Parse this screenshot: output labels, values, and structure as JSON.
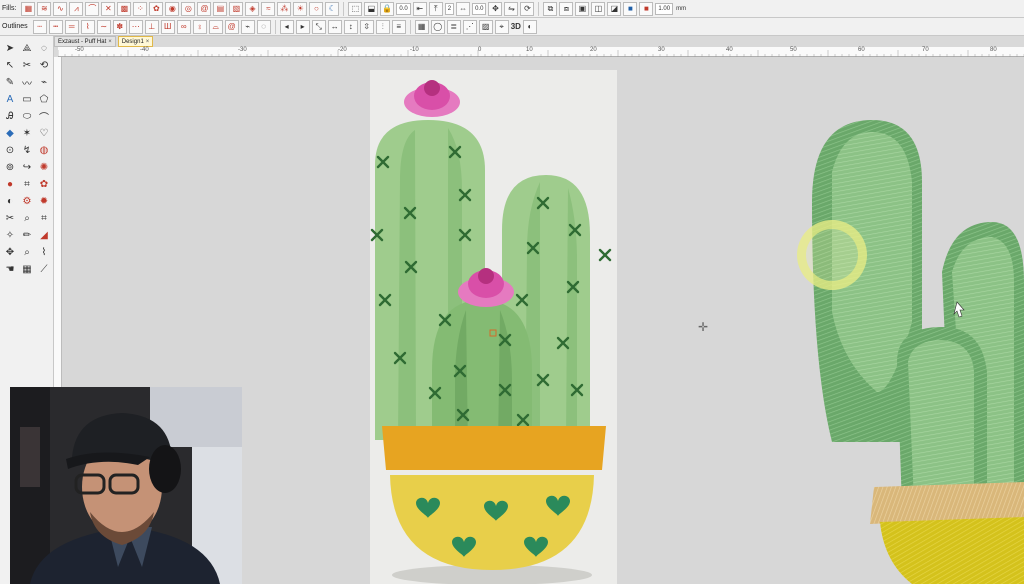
{
  "toolbar": {
    "fills_label": "Fills:",
    "outlines_label": "Outlines",
    "zoom_value": "1.00",
    "zoom_unit": "mm",
    "view_3d_label": "3D",
    "field_values": [
      "0.0",
      "2",
      "0.0"
    ],
    "icons": [
      "fill-stitch-icon",
      "satin-icon",
      "outline-icon",
      "select-icon",
      "lock-icon",
      "align-icon",
      "color-icon"
    ]
  },
  "tabs": [
    {
      "label": "Exzaust - Puff Hat",
      "active": false
    },
    {
      "label": "Design1",
      "active": true
    }
  ],
  "ruler": {
    "top_labels": [
      "-50",
      "-40",
      "-30",
      "-20",
      "-10",
      "0",
      "10",
      "20",
      "30",
      "40",
      "50",
      "60",
      "70",
      "80"
    ]
  },
  "colors": {
    "cactus_light": "#9fcc8d",
    "cactus_mid": "#84bb73",
    "cactus_stripe": "#72aa64",
    "spine": "#2f6b33",
    "flower": "#d94fa8",
    "pot_rim": "#e7a421",
    "pot_body": "#e8cf4a",
    "heart": "#2b8a5b",
    "embroidery_green": "#6aa86a",
    "embroidery_pot": "#d4c21c",
    "embroidery_rim": "#d9b77a"
  }
}
